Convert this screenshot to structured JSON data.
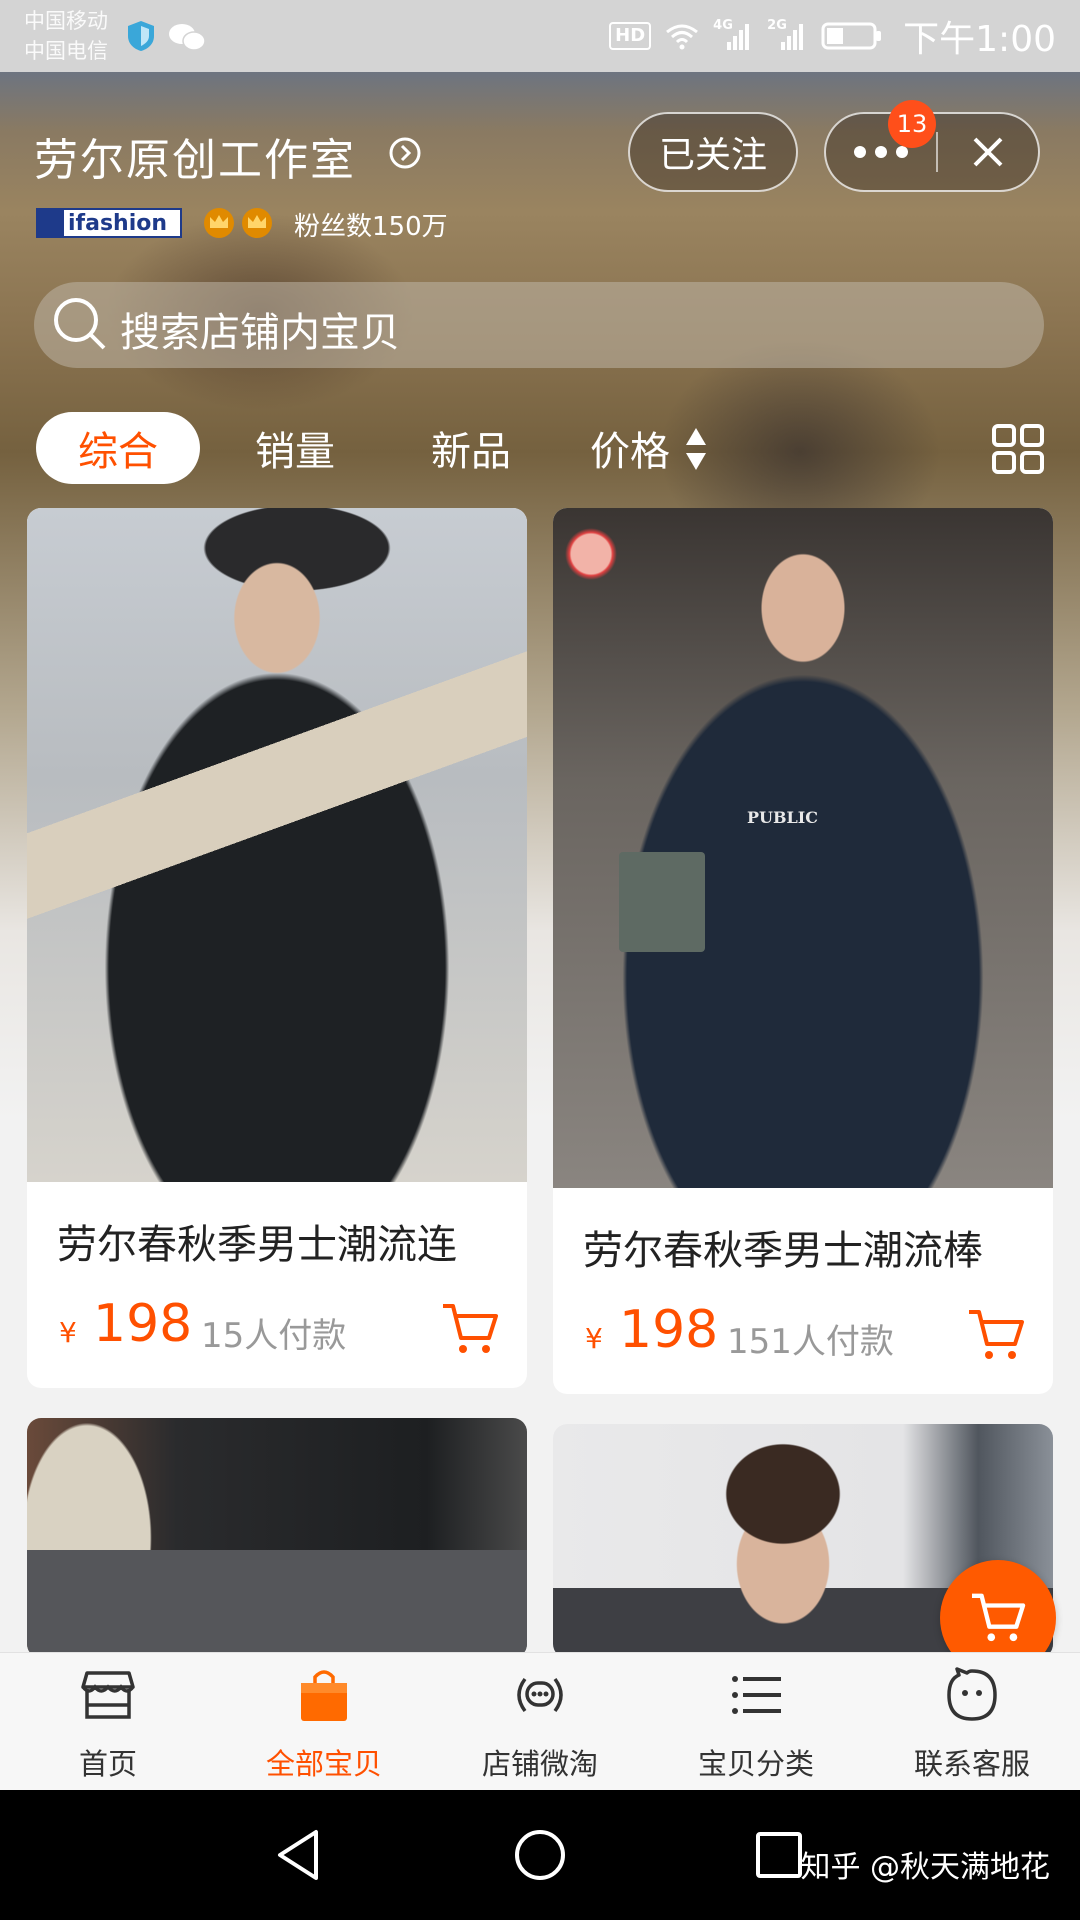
{
  "status_bar": {
    "carrier_1": "中国移动",
    "carrier_2": "中国电信",
    "hd": "HD",
    "net_1": "4G",
    "net_2": "2G",
    "time": "下午1:00"
  },
  "shop": {
    "name": "劳尔原创工作室",
    "follow_label": "已关注",
    "message_badge": "13",
    "brand_logo_text": "ifashion",
    "fans": "粉丝数150万"
  },
  "search": {
    "placeholder": "搜索店铺内宝贝"
  },
  "sort_tabs": [
    {
      "label": "综合",
      "active": true
    },
    {
      "label": "销量",
      "active": false
    },
    {
      "label": "新品",
      "active": false
    },
    {
      "label": "价格",
      "active": false
    }
  ],
  "products": [
    {
      "title": "劳尔春秋季男士潮流连",
      "currency": "¥",
      "price": "198",
      "paid": "15人付款"
    },
    {
      "title": "劳尔春秋季男士潮流棒",
      "currency": "¥",
      "price": "198",
      "paid": "151人付款"
    },
    {
      "title": "",
      "currency": "",
      "price": "",
      "paid": ""
    },
    {
      "title": "",
      "currency": "",
      "price": "",
      "paid": ""
    }
  ],
  "product_2_print": "PUBLIC",
  "tabbar": [
    {
      "label": "首页",
      "icon": "storefront-icon",
      "active": false
    },
    {
      "label": "全部宝贝",
      "icon": "shopping-bag-icon",
      "active": true
    },
    {
      "label": "店铺微淘",
      "icon": "broadcast-icon",
      "active": false
    },
    {
      "label": "宝贝分类",
      "icon": "list-icon",
      "active": false
    },
    {
      "label": "联系客服",
      "icon": "smiley-chat-icon",
      "active": false
    }
  ],
  "watermark": "知乎 @秋天满地花",
  "colors": {
    "accent": "#ff5000",
    "status_bar_bg": "#d4d4d4",
    "nav_bar_bg": "#000000",
    "badge": "#ff4f1a"
  }
}
